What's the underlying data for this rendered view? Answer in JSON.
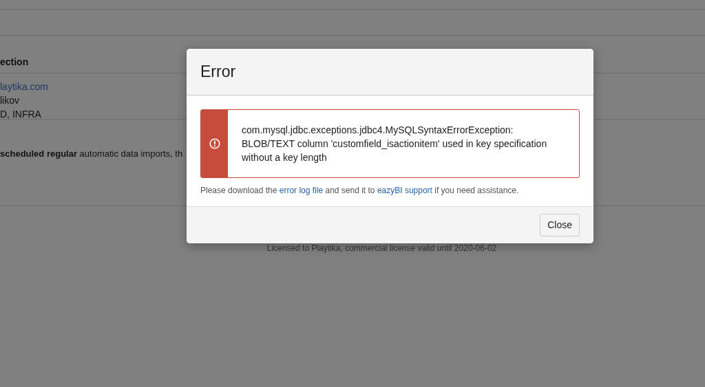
{
  "page": {
    "section_heading": "ection",
    "details": [
      {
        "kind": "link",
        "text": "laytika.com"
      },
      {
        "kind": "text",
        "text": "likov"
      },
      {
        "kind": "text",
        "text": "D, INFRA"
      }
    ],
    "note": "**scheduled regular** automatic data imports, th",
    "footer": "Licensed to Playtika, commercial license valid until 2020-06-02"
  },
  "dialog": {
    "title": "Error",
    "alert": {
      "message": "com.mysql.jdbc.exceptions.jdbc4.MySQLSyntaxErrorException: BLOB/TEXT column 'customfield_isactionitem' used in key specification without a key length"
    },
    "help": [
      {
        "kind": "text",
        "text": "Please download the"
      },
      {
        "kind": "link",
        "text": "error log file"
      },
      {
        "kind": "text",
        "text": "and send it to"
      },
      {
        "kind": "link",
        "text": "eazyBI support"
      },
      {
        "kind": "text",
        "text": "if you need assistance."
      }
    ],
    "buttons": [
      "Close"
    ]
  }
}
